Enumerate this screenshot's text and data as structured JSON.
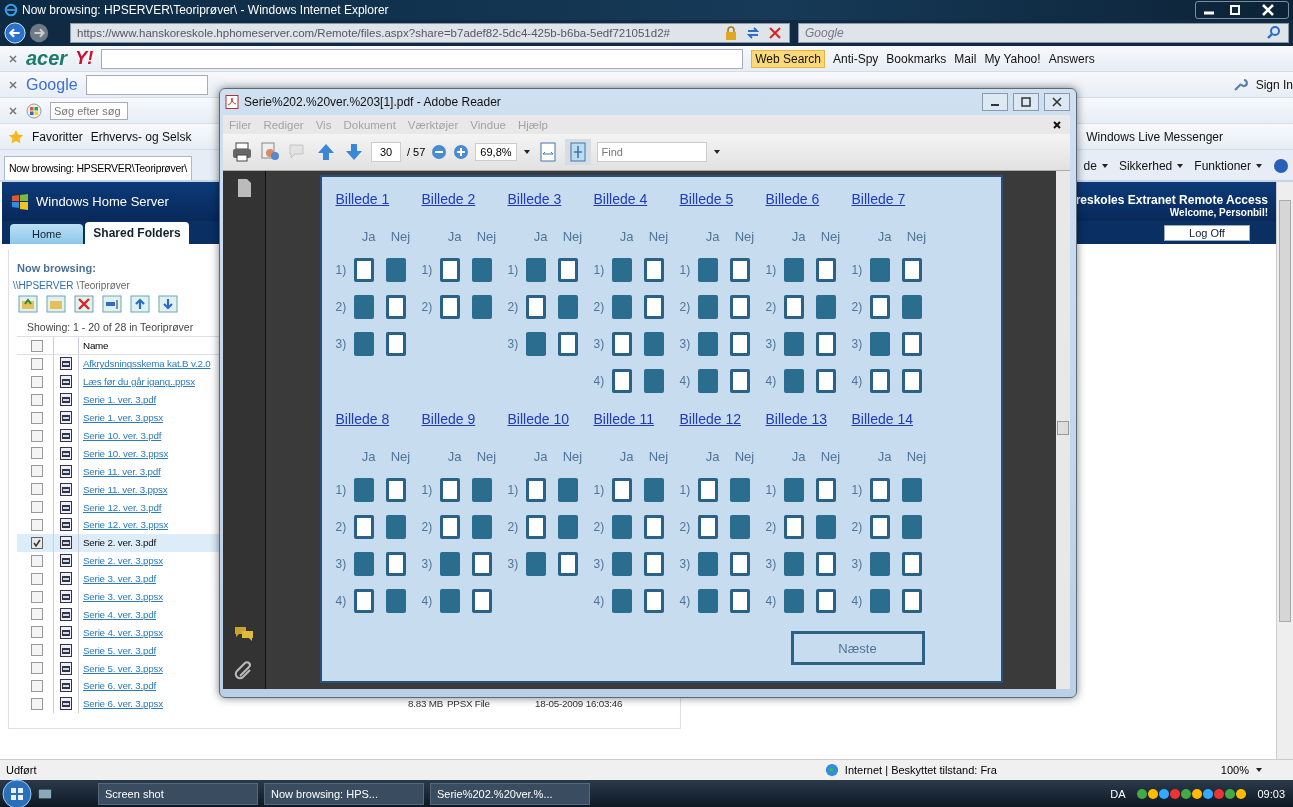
{
  "browser": {
    "title": "Now browsing: HPSERVER\\Teoriprøver\\ - Windows Internet Explorer",
    "address": "https://www.hanskoreskole.hphomeserver.com/Remote/files.aspx?share=b7adef82-5dc4-425b-b6ba-5edf721051d2#",
    "search_placeholder": "Google",
    "acer_toolbar": {
      "logo": "acer",
      "yahoo_logo": "Y!",
      "items": [
        {
          "label": "Web Search",
          "highlighted": true
        },
        {
          "label": "Anti-Spy",
          "highlighted": false
        },
        {
          "label": "Bookmarks",
          "highlighted": false
        },
        {
          "label": "Mail",
          "highlighted": false
        },
        {
          "label": "My Yahoo!",
          "highlighted": false
        },
        {
          "label": "Answers",
          "highlighted": false
        }
      ]
    },
    "google_toolbar": {
      "logo": "Google",
      "sign_in": "Sign In"
    },
    "live_toolbar": {
      "placeholder": "Søg efter søg"
    },
    "favorites_bar": {
      "label": "Favoritter",
      "items": [
        "Erhvervs- og Selsk",
        "Windows Live Messenger"
      ]
    },
    "tab": {
      "title": "Now browsing: HPSERVER\\Teoriprøver\\"
    },
    "commands": [
      "de",
      "Sikkerhed",
      "Funktioner"
    ],
    "status_bar": {
      "text": "Udført",
      "zone": "Internet | Beskyttet tilstand: Fra",
      "zoom": "100%"
    }
  },
  "web_page": {
    "brand": "Windows Home Server",
    "tabs": [
      {
        "label": "Home",
        "selected": false
      },
      {
        "label": "Shared Folders",
        "selected": true
      }
    ],
    "site_title": "reskoles Extranet Remote Access",
    "welcome": "Welcome, Personbil!",
    "log_off": "Log Off",
    "now_browsing": "Now browsing:",
    "breadcrumb": [
      "\\\\HPSERVER",
      "\\Teoriprøver"
    ],
    "showing": "Showing: 1 - 20 of 28 in Teoriprøver",
    "name_column": "Name",
    "all_selected": false,
    "files": [
      {
        "name": "Afkrydsningsskema kat.B v.2.0",
        "checked": false
      },
      {
        "name": "Læs før du går igang..ppsx",
        "checked": false
      },
      {
        "name": "Serie 1. ver. 3.pdf",
        "checked": false
      },
      {
        "name": "Serie 1. ver. 3.ppsx",
        "checked": false
      },
      {
        "name": "Serie 10. ver. 3.pdf",
        "checked": false
      },
      {
        "name": "Serie 10. ver. 3.ppsx",
        "checked": false
      },
      {
        "name": "Serie 11. ver. 3.pdf",
        "checked": false
      },
      {
        "name": "Serie 11. ver. 3.ppsx",
        "checked": false
      },
      {
        "name": "Serie 12. ver. 3.pdf",
        "checked": false
      },
      {
        "name": "Serie 12. ver. 3.ppsx",
        "checked": false
      },
      {
        "name": "Serie 2. ver. 3.pdf",
        "checked": true
      },
      {
        "name": "Serie 2. ver. 3.ppsx",
        "checked": false
      },
      {
        "name": "Serie 3. ver. 3.pdf",
        "checked": false
      },
      {
        "name": "Serie 3. ver. 3.ppsx",
        "checked": false
      },
      {
        "name": "Serie 4. ver. 3.pdf",
        "checked": false
      },
      {
        "name": "Serie 4. ver. 3.ppsx",
        "checked": false
      },
      {
        "name": "Serie 5. ver. 3.pdf",
        "checked": false
      },
      {
        "name": "Serie 5. ver. 3.ppsx",
        "checked": false
      },
      {
        "name": "Serie 6. ver. 3.pdf",
        "checked": false
      },
      {
        "name": "Serie 6. ver. 3.ppsx",
        "checked": false,
        "size": "8.83 MB",
        "type": "PPSX File",
        "modified": "18-05-2009 16:03:46"
      }
    ]
  },
  "reader": {
    "title": "Serie%202.%20ver.%203[1].pdf - Adobe Reader",
    "menu": [
      "Filer",
      "Rediger",
      "Vis",
      "Dokument",
      "Værktøjer",
      "Vindue",
      "Hjælp"
    ],
    "page": "30",
    "page_count": "/ 57",
    "zoom": "69,8%",
    "find_placeholder": "Find",
    "document": {
      "sections": [
        {
          "pictures": [
            {
              "label": "Billede 1",
              "ja": "Ja",
              "nej": "Nej",
              "answers": [
                {
                  "number": "1)",
                  "ja": false,
                  "nej": true
                },
                {
                  "number": "2)",
                  "ja": true,
                  "nej": false
                },
                {
                  "number": "3)",
                  "ja": true,
                  "nej": false
                }
              ]
            },
            {
              "label": "Billede 2",
              "ja": "Ja",
              "nej": "Nej",
              "answers": [
                {
                  "number": "1)",
                  "ja": false,
                  "nej": true
                },
                {
                  "number": "2)",
                  "ja": false,
                  "nej": true
                }
              ]
            },
            {
              "label": "Billede 3",
              "ja": "Ja",
              "nej": "Nej",
              "answers": [
                {
                  "number": "1)",
                  "ja": true,
                  "nej": false
                },
                {
                  "number": "2)",
                  "ja": false,
                  "nej": true
                },
                {
                  "number": "3)",
                  "ja": true,
                  "nej": false
                }
              ]
            },
            {
              "label": "Billede 4",
              "ja": "Ja",
              "nej": "Nej",
              "answers": [
                {
                  "number": "1)",
                  "ja": true,
                  "nej": false
                },
                {
                  "number": "2)",
                  "ja": true,
                  "nej": false
                },
                {
                  "number": "3)",
                  "ja": false,
                  "nej": true
                },
                {
                  "number": "4)",
                  "ja": false,
                  "nej": true
                }
              ]
            },
            {
              "label": "Billede 5",
              "ja": "Ja",
              "nej": "Nej",
              "answers": [
                {
                  "number": "1)",
                  "ja": true,
                  "nej": false
                },
                {
                  "number": "2)",
                  "ja": true,
                  "nej": false
                },
                {
                  "number": "3)",
                  "ja": true,
                  "nej": false
                },
                {
                  "number": "4)",
                  "ja": true,
                  "nej": false
                }
              ]
            },
            {
              "label": "Billede 6",
              "ja": "Ja",
              "nej": "Nej",
              "answers": [
                {
                  "number": "1)",
                  "ja": true,
                  "nej": false
                },
                {
                  "number": "2)",
                  "ja": false,
                  "nej": true
                },
                {
                  "number": "3)",
                  "ja": true,
                  "nej": false
                },
                {
                  "number": "4)",
                  "ja": true,
                  "nej": false
                }
              ]
            },
            {
              "label": "Billede 7",
              "ja": "Ja",
              "nej": "Nej",
              "answers": [
                {
                  "number": "1)",
                  "ja": true,
                  "nej": false
                },
                {
                  "number": "2)",
                  "ja": false,
                  "nej": true
                },
                {
                  "number": "3)",
                  "ja": true,
                  "nej": false
                },
                {
                  "number": "4)",
                  "ja": false,
                  "nej": false
                }
              ]
            }
          ]
        },
        {
          "pictures": [
            {
              "label": "Billede 8",
              "ja": "Ja",
              "nej": "Nej",
              "answers": [
                {
                  "number": "1)",
                  "ja": true,
                  "nej": false
                },
                {
                  "number": "2)",
                  "ja": false,
                  "nej": true
                },
                {
                  "number": "3)",
                  "ja": true,
                  "nej": false
                },
                {
                  "number": "4)",
                  "ja": false,
                  "nej": true
                }
              ]
            },
            {
              "label": "Billede 9",
              "ja": "Ja",
              "nej": "Nej",
              "answers": [
                {
                  "number": "1)",
                  "ja": false,
                  "nej": true
                },
                {
                  "number": "2)",
                  "ja": false,
                  "nej": true
                },
                {
                  "number": "3)",
                  "ja": true,
                  "nej": false
                },
                {
                  "number": "4)",
                  "ja": true,
                  "nej": false
                }
              ]
            },
            {
              "label": "Billede 10",
              "ja": "Ja",
              "nej": "Nej",
              "answers": [
                {
                  "number": "1)",
                  "ja": false,
                  "nej": true
                },
                {
                  "number": "2)",
                  "ja": false,
                  "nej": true
                },
                {
                  "number": "3)",
                  "ja": true,
                  "nej": false
                }
              ]
            },
            {
              "label": "Billede 11",
              "ja": "Ja",
              "nej": "Nej",
              "answers": [
                {
                  "number": "1)",
                  "ja": false,
                  "nej": true
                },
                {
                  "number": "2)",
                  "ja": true,
                  "nej": false
                },
                {
                  "number": "3)",
                  "ja": true,
                  "nej": false
                },
                {
                  "number": "4)",
                  "ja": true,
                  "nej": false
                }
              ]
            },
            {
              "label": "Billede 12",
              "ja": "Ja",
              "nej": "Nej",
              "answers": [
                {
                  "number": "1)",
                  "ja": false,
                  "nej": true
                },
                {
                  "number": "2)",
                  "ja": false,
                  "nej": true
                },
                {
                  "number": "3)",
                  "ja": true,
                  "nej": false
                },
                {
                  "number": "4)",
                  "ja": true,
                  "nej": false
                }
              ]
            },
            {
              "label": "Billede 13",
              "ja": "Ja",
              "nej": "Nej",
              "answers": [
                {
                  "number": "1)",
                  "ja": true,
                  "nej": false
                },
                {
                  "number": "2)",
                  "ja": false,
                  "nej": true
                },
                {
                  "number": "3)",
                  "ja": true,
                  "nej": false
                },
                {
                  "number": "4)",
                  "ja": true,
                  "nej": false
                }
              ]
            },
            {
              "label": "Billede 14",
              "ja": "Ja",
              "nej": "Nej",
              "answers": [
                {
                  "number": "1)",
                  "ja": false,
                  "nej": true
                },
                {
                  "number": "2)",
                  "ja": false,
                  "nej": true
                },
                {
                  "number": "3)",
                  "ja": true,
                  "nej": false
                },
                {
                  "number": "4)",
                  "ja": true,
                  "nej": false
                }
              ]
            }
          ]
        }
      ],
      "next_button": "Næste"
    }
  },
  "taskbar": {
    "items": [
      "Screen shot",
      "Now browsing: HPS...",
      "Serie%202.%20ver.%..."
    ],
    "language": "DA",
    "clock": "09:03"
  }
}
